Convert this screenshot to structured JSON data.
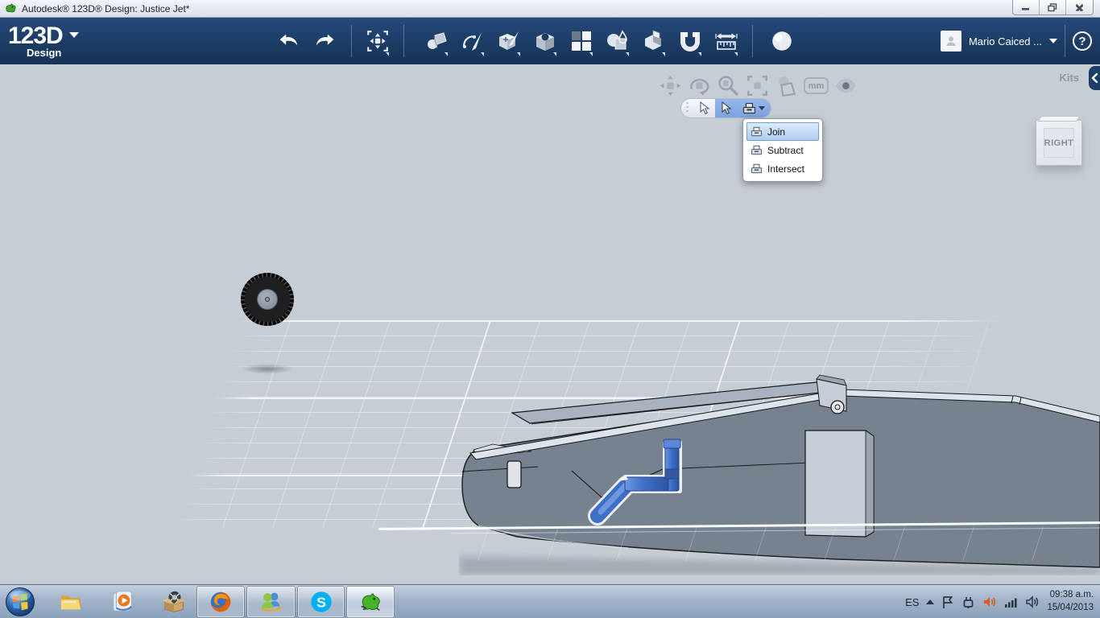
{
  "window": {
    "title": "Autodesk® 123D® Design: Justice Jet*"
  },
  "header": {
    "logo_text": "123D",
    "logo_sub": "Design",
    "user_name": "Mario Caiced ...",
    "help_label": "?"
  },
  "viewport": {
    "kits_label": "Kits",
    "units_label": "mm",
    "view_cube_face": "RIGHT",
    "combine_menu": {
      "items": [
        {
          "label": "Join"
        },
        {
          "label": "Subtract"
        },
        {
          "label": "Intersect"
        }
      ]
    }
  },
  "taskbar": {
    "tray": {
      "language": "ES",
      "time": "09:38 a.m.",
      "date": "15/04/2013"
    }
  },
  "icons": {
    "skype_glyph": "S"
  },
  "colors": {
    "header_navy": "#1c3c64",
    "viewport_bg": "#c7cdd5",
    "selection_blue": "#7aa3df",
    "body_gray": "#76828f",
    "selected_part_blue": "#3d6fc7",
    "tray_speaker_orange": "#d95b1e"
  }
}
